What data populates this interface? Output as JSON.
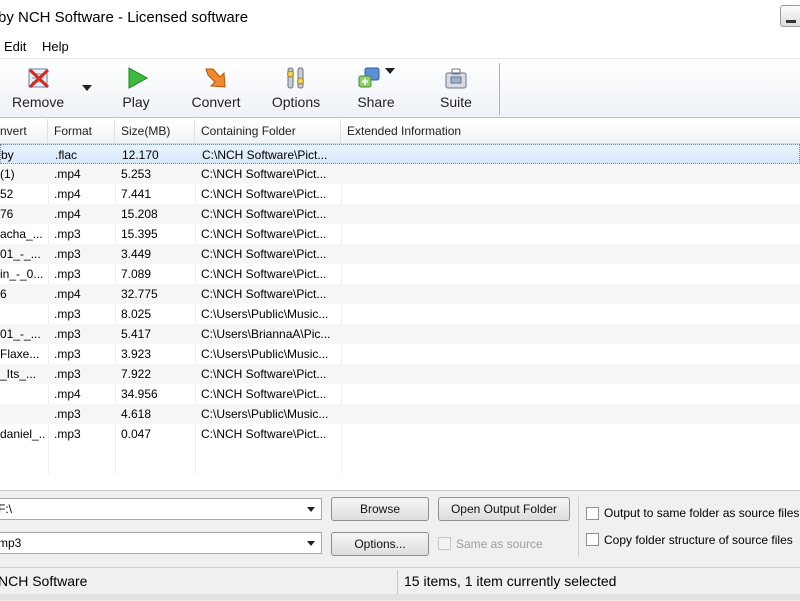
{
  "window": {
    "title": "by NCH Software - Licensed software"
  },
  "menu": {
    "edit": "Edit",
    "help": "Help"
  },
  "toolbar": {
    "remove": "Remove",
    "play": "Play",
    "convert": "Convert",
    "options": "Options",
    "share": "Share",
    "suite": "Suite"
  },
  "columns": {
    "name": "nvert",
    "format": "Format",
    "size": "Size(MB)",
    "folder": "Containing Folder",
    "extended": "Extended Information"
  },
  "rows": [
    {
      "name": "by",
      "format": ".flac",
      "size": "12.170",
      "folder": "C:\\NCH Software\\Pict...",
      "extended": ""
    },
    {
      "name": " (1)",
      "format": ".mp4",
      "size": "5.253",
      "folder": "C:\\NCH Software\\Pict...",
      "extended": ""
    },
    {
      "name": "52",
      "format": ".mp4",
      "size": "7.441",
      "folder": "C:\\NCH Software\\Pict...",
      "extended": ""
    },
    {
      "name": "76",
      "format": ".mp4",
      "size": "15.208",
      "folder": "C:\\NCH Software\\Pict...",
      "extended": ""
    },
    {
      "name": "acha_...",
      "format": ".mp3",
      "size": "15.395",
      "folder": "C:\\NCH Software\\Pict...",
      "extended": ""
    },
    {
      "name": "01_-_...",
      "format": ".mp3",
      "size": "3.449",
      "folder": "C:\\NCH Software\\Pict...",
      "extended": ""
    },
    {
      "name": "in_-_0...",
      "format": ".mp3",
      "size": "7.089",
      "folder": "C:\\NCH Software\\Pict...",
      "extended": ""
    },
    {
      "name": "6",
      "format": ".mp4",
      "size": "32.775",
      "folder": "C:\\NCH Software\\Pict...",
      "extended": ""
    },
    {
      "name": "",
      "format": ".mp3",
      "size": "8.025",
      "folder": "C:\\Users\\Public\\Music...",
      "extended": ""
    },
    {
      "name": "01_-_...",
      "format": ".mp3",
      "size": "5.417",
      "folder": "C:\\Users\\BriannaA\\Pic...",
      "extended": ""
    },
    {
      "name": " Flaxe...",
      "format": ".mp3",
      "size": "3.923",
      "folder": "C:\\Users\\Public\\Music...",
      "extended": ""
    },
    {
      "name": "_Its_...",
      "format": ".mp3",
      "size": "7.922",
      "folder": "C:\\NCH Software\\Pict...",
      "extended": ""
    },
    {
      "name": "",
      "format": ".mp4",
      "size": "34.956",
      "folder": "C:\\NCH Software\\Pict...",
      "extended": ""
    },
    {
      "name": "",
      "format": ".mp3",
      "size": "4.618",
      "folder": "C:\\Users\\Public\\Music...",
      "extended": ""
    },
    {
      "name": "daniel_...",
      "format": ".mp3",
      "size": "0.047",
      "folder": "C:\\NCH Software\\Pict...",
      "extended": ""
    }
  ],
  "output": {
    "folder_value": "F:\\",
    "format_value": "mp3",
    "browse": "Browse",
    "open_output_folder": "Open Output Folder",
    "options": "Options...",
    "same_as_source": "Same as source",
    "output_same_folder": "Output to same folder as source files",
    "copy_folder_structure": "Copy folder structure of source files"
  },
  "status": {
    "left": "NCH Software",
    "right": "15 items, 1 item currently selected"
  }
}
